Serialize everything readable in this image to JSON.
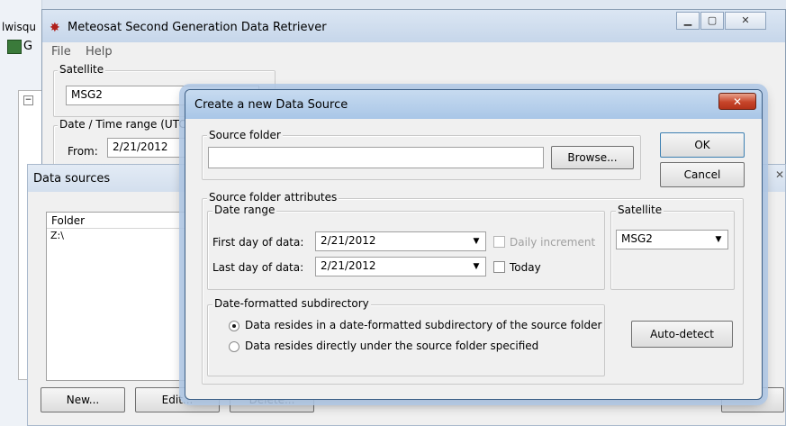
{
  "background": {
    "left_text": "lwisqu",
    "left_letter": "G"
  },
  "main_window": {
    "title": "Meteosat Second Generation Data Retriever",
    "menu": [
      "File",
      "Help"
    ],
    "satellite_group": "Satellite",
    "satellite_value": "MSG2",
    "datetime_group": "Date / Time range (UTC)",
    "from_label": "From:",
    "from_value": "2/21/2012"
  },
  "data_sources_window": {
    "title": "Data sources",
    "column_folder": "Folder",
    "rows": [
      "Z:\\"
    ],
    "new_button": "New...",
    "edit_button": "Edit...",
    "delete_button": "Delete..."
  },
  "dialog": {
    "title": "Create a new Data Source",
    "source_folder_group": "Source folder",
    "source_folder_value": "",
    "browse_button": "Browse...",
    "ok_button": "OK",
    "cancel_button": "Cancel",
    "attributes_group": "Source folder attributes",
    "date_range_group": "Date range",
    "first_day_label": "First day of data:",
    "first_day_value": "2/21/2012",
    "last_day_label": "Last day of data:",
    "last_day_value": "2/21/2012",
    "daily_increment_label": "Daily increment",
    "daily_increment_checked": false,
    "today_label": "Today",
    "today_checked": false,
    "satellite_group": "Satellite",
    "satellite_value": "MSG2",
    "subdir_group": "Date-formatted subdirectory",
    "radio_subdir_label": "Data resides in a date-formatted subdirectory of the source folder",
    "radio_direct_label": "Data resides directly under the source folder specified",
    "selected_radio": "subdir",
    "auto_detect_button": "Auto-detect"
  },
  "colors": {
    "close_button": "#c7452a",
    "title_gradient": "#a9c6e7"
  }
}
